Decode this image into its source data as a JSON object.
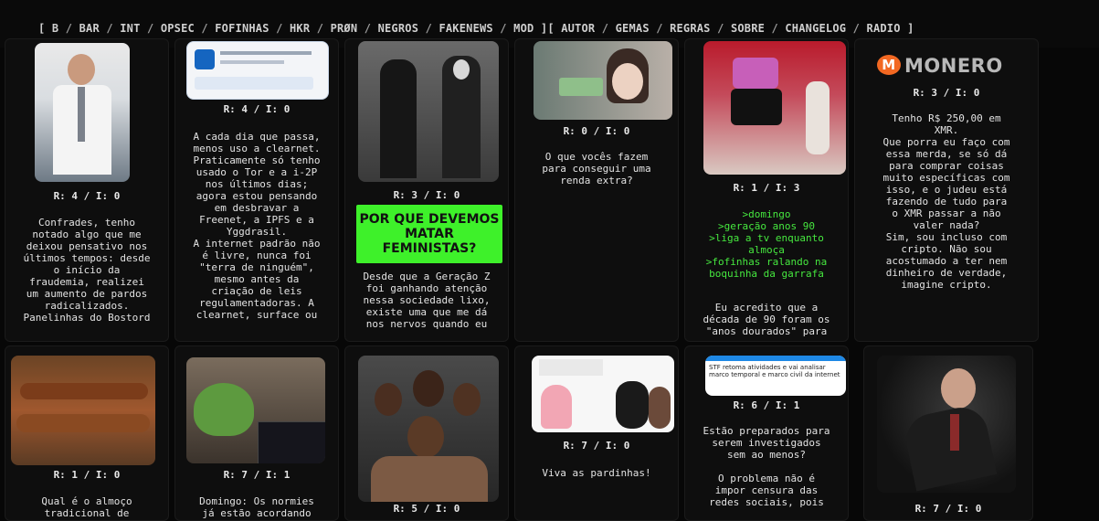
{
  "nav": {
    "open": "[",
    "close": "]",
    "boards": [
      "B",
      "BAR",
      "INT",
      "OPSEC",
      "FOFINHAS",
      "HKR",
      "PRØN",
      "NEGROS",
      "FAKENEWS",
      "MOD"
    ],
    "mid": "][",
    "pages": [
      "AUTOR",
      "GEMAS",
      "REGRAS",
      "SOBRE",
      "CHANGELOG",
      "RADIO"
    ]
  },
  "threads": [
    {
      "meta": "R: 4 / I: 0",
      "text": "Confrades, tenho\nnotado algo que me\ndeixou pensativo nos\núltimos tempos: desde\no início da\nfraudemia, realizei\num aumento de pardos\nradicalizados.\nPanelinhas do Bostord"
    },
    {
      "meta": "R: 4 / I: 0",
      "text": "A cada dia que passa,\nmenos uso a clearnet.\nPraticamente só tenho\nusado o Tor e a i-2P\nnos últimos dias;\nagora estou pensando\nem desbravar a\nFreenet, a IPFS e a\nYggdrasil.\nA internet padrão não\né livre, nunca foi\n\"terra de ninguém\",\nmesmo antes da\ncriação de leis\nregulamentadoras. A\nclearnet, surface ou"
    },
    {
      "meta": "R: 3 / I: 0",
      "banner": "POR QUE DEVEMOS\nMATAR\nFEMINISTAS?",
      "text": "Desde que a Geração Z\nfoi ganhando atenção\nnessa sociedade lixo,\nexiste uma que me dá\nnos nervos quando eu"
    },
    {
      "meta": "R: 0 / I: 0",
      "text": "O que vocês fazem\npara conseguir uma\nrenda extra?"
    },
    {
      "meta": "R: 1 / I: 3",
      "green": ">domingo\n>geração anos 90\n>liga a tv enquanto\nalmoça\n>fofinhas ralando na\nboquinha da garrafa",
      "text": "Eu acredito que a\ndécada de 90 foram os\n\"anos dourados\" para"
    },
    {
      "meta": "R: 3 / I: 0",
      "logo": "MONERO",
      "text": "Tenho R$ 250,00 em\nXMR.\nQue porra eu faço com\nessa merda, se só dá\npara comprar coisas\nmuito específicas com\nisso, e o judeu está\nfazendo de tudo para\no XMR passar a não\nvaler nada?\nSim, sou incluso com\ncripto. Não sou\nacostumado a ter nem\ndinheiro de verdade,\nimagine cripto."
    },
    {
      "meta": "R: 1 / I: 0",
      "text": "Qual é o almoço\ntradicional de"
    },
    {
      "meta": "R: 7 / I: 1",
      "text": "Domingo: Os normies\njá estão acordando"
    },
    {
      "meta": "R: 5 / I: 0",
      "text": ""
    },
    {
      "meta": "R: 7 / I: 0",
      "text": "Viva as pardinhas!"
    },
    {
      "meta": "R: 6 / I: 1",
      "thumb_caption": "STF retoma atividades e vai analisar marco temporal e marco civil da internet",
      "text": "Estão preparados para\nserem investigados\nsem ao menos?\n\nO problema não é\nimpor censura das\nredes sociais, pois"
    },
    {
      "meta": "R: 7 / I: 0",
      "text": ""
    }
  ]
}
